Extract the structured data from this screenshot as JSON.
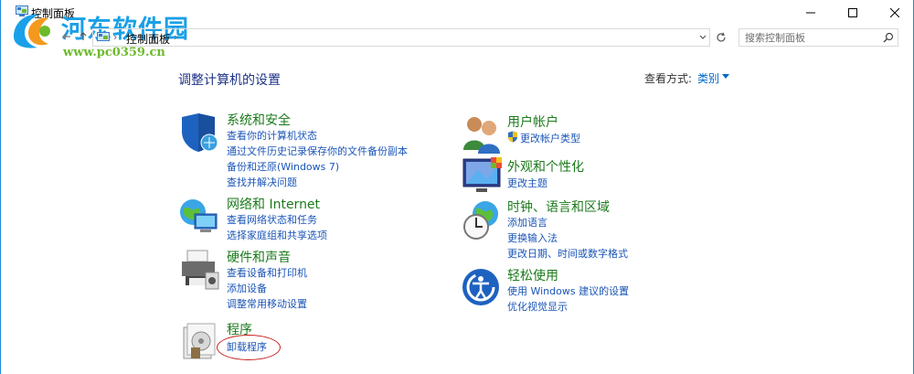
{
  "window": {
    "title": "控制面板",
    "controls": {
      "minimize": "—",
      "maximize": "☐",
      "close": "✕"
    }
  },
  "watermark": {
    "title": "河东软件园",
    "url": "www.pc0359.cn"
  },
  "address": {
    "crumb": "控制面板",
    "separator": "›",
    "search_placeholder": "搜索控制面板"
  },
  "heading": {
    "title": "调整计算机的设置",
    "view_label": "查看方式:",
    "view_value": "类别"
  },
  "categories": [
    {
      "id": "system-security",
      "icon": "shield-icon",
      "title": "系统和安全",
      "links": [
        "查看你的计算机状态",
        "通过文件历史记录保存你的文件备份副本",
        "备份和还原(Windows 7)",
        "查找并解决问题"
      ]
    },
    {
      "id": "network",
      "icon": "globe-network-icon",
      "title": "网络和 Internet",
      "links": [
        "查看网络状态和任务",
        "选择家庭组和共享选项"
      ]
    },
    {
      "id": "hardware",
      "icon": "printer-icon",
      "title": "硬件和声音",
      "links": [
        "查看设备和打印机",
        "添加设备",
        "调整常用移动设置"
      ]
    },
    {
      "id": "programs",
      "icon": "programs-icon",
      "title": "程序",
      "links": [
        "卸载程序"
      ]
    },
    {
      "id": "user-accounts",
      "icon": "users-icon",
      "title": "用户帐户",
      "links": [
        "更改帐户类型"
      ]
    },
    {
      "id": "appearance",
      "icon": "monitor-icon",
      "title": "外观和个性化",
      "links": [
        "更改主题"
      ]
    },
    {
      "id": "clock-region",
      "icon": "clock-globe-icon",
      "title": "时钟、语言和区域",
      "links": [
        "添加语言",
        "更换输入法",
        "更改日期、时间或数字格式"
      ]
    },
    {
      "id": "ease-of-access",
      "icon": "accessibility-icon",
      "title": "轻松使用",
      "links": [
        "使用 Windows 建议的设置",
        "优化视觉显示"
      ]
    }
  ],
  "colors": {
    "category_title": "#1b7a1b",
    "link": "#1a55b8",
    "page_title": "#1e3287",
    "highlight_circle": "#c81e1e"
  }
}
